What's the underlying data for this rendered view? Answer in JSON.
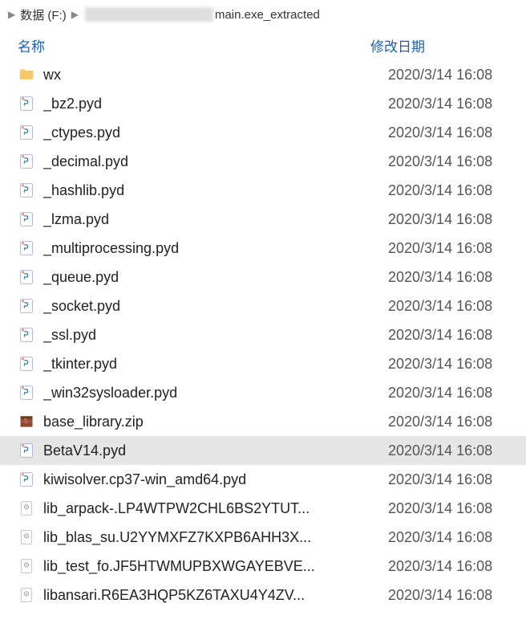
{
  "breadcrumb": {
    "drive": "数据 (F:)",
    "folder": "main.exe_extracted"
  },
  "columns": {
    "name": "名称",
    "date": "修改日期"
  },
  "files": [
    {
      "icon": "folder",
      "name": "wx",
      "date": "2020/3/14 16:08",
      "selected": false
    },
    {
      "icon": "pyd",
      "name": "_bz2.pyd",
      "date": "2020/3/14 16:08",
      "selected": false
    },
    {
      "icon": "pyd",
      "name": "_ctypes.pyd",
      "date": "2020/3/14 16:08",
      "selected": false
    },
    {
      "icon": "pyd",
      "name": "_decimal.pyd",
      "date": "2020/3/14 16:08",
      "selected": false
    },
    {
      "icon": "pyd",
      "name": "_hashlib.pyd",
      "date": "2020/3/14 16:08",
      "selected": false
    },
    {
      "icon": "pyd",
      "name": "_lzma.pyd",
      "date": "2020/3/14 16:08",
      "selected": false
    },
    {
      "icon": "pyd",
      "name": "_multiprocessing.pyd",
      "date": "2020/3/14 16:08",
      "selected": false
    },
    {
      "icon": "pyd",
      "name": "_queue.pyd",
      "date": "2020/3/14 16:08",
      "selected": false
    },
    {
      "icon": "pyd",
      "name": "_socket.pyd",
      "date": "2020/3/14 16:08",
      "selected": false
    },
    {
      "icon": "pyd",
      "name": "_ssl.pyd",
      "date": "2020/3/14 16:08",
      "selected": false
    },
    {
      "icon": "pyd",
      "name": "_tkinter.pyd",
      "date": "2020/3/14 16:08",
      "selected": false
    },
    {
      "icon": "pyd",
      "name": "_win32sysloader.pyd",
      "date": "2020/3/14 16:08",
      "selected": false
    },
    {
      "icon": "zip",
      "name": "base_library.zip",
      "date": "2020/3/14 16:08",
      "selected": false
    },
    {
      "icon": "pyd",
      "name": "BetaV14.pyd",
      "date": "2020/3/14 16:08",
      "selected": true
    },
    {
      "icon": "pyd",
      "name": "kiwisolver.cp37-win_amd64.pyd",
      "date": "2020/3/14 16:08",
      "selected": false
    },
    {
      "icon": "file",
      "name": "lib_arpack-.LP4WTPW2CHL6BS2YTUT...",
      "date": "2020/3/14 16:08",
      "selected": false
    },
    {
      "icon": "file",
      "name": "lib_blas_su.U2YYMXFZ7KXPB6AHH3X...",
      "date": "2020/3/14 16:08",
      "selected": false
    },
    {
      "icon": "file",
      "name": "lib_test_fo.JF5HTWMUPBXWGAYEBVE...",
      "date": "2020/3/14 16:08",
      "selected": false
    },
    {
      "icon": "file",
      "name": "libansari.R6EA3HQP5KZ6TAXU4Y4ZV...",
      "date": "2020/3/14 16:08",
      "selected": false
    }
  ]
}
